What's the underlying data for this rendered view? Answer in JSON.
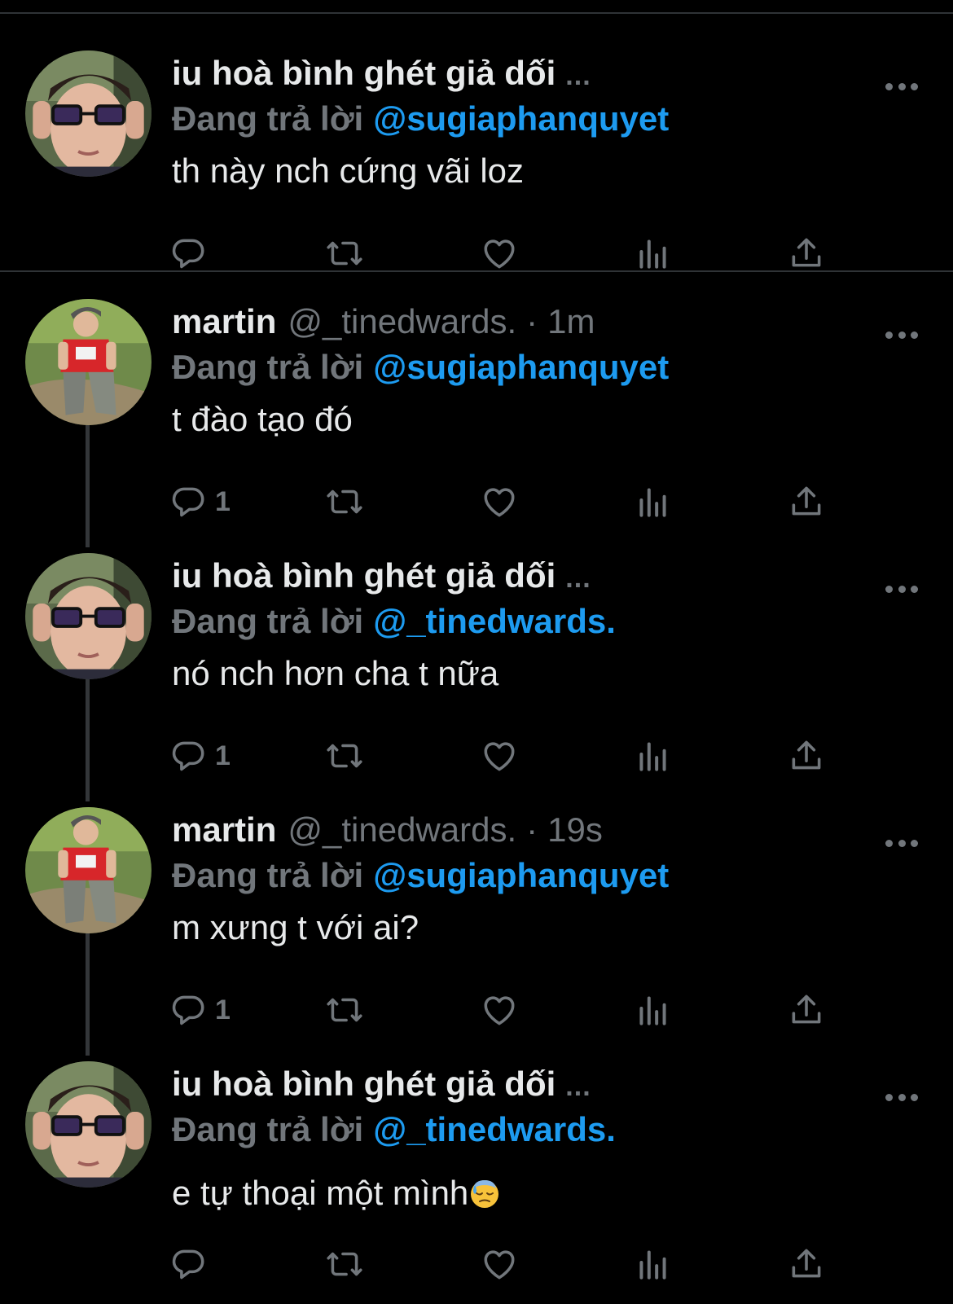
{
  "colors": {
    "background": "#000000",
    "text": "#e7e9ea",
    "muted": "#71767b",
    "accent": "#1d9bf0",
    "divider": "#2f3336"
  },
  "reply_prefix": "Đang trả lời",
  "ellipsis": "...",
  "tweets": [
    {
      "author_name": "iu hoà bình ghét giả dối",
      "handle": "",
      "time": "",
      "reply_to": "@sugiaphanquyet",
      "text": "th này nch cứng vãi loz",
      "reply_count": "",
      "avatar": "avatar-glasses"
    },
    {
      "author_name": "martin",
      "handle": "@_tinedwards.",
      "separator": "·",
      "time": "1m",
      "reply_to": "@sugiaphanquyet",
      "text": "t đào tạo đó",
      "reply_count": "1",
      "avatar": "avatar-red-shirt"
    },
    {
      "author_name": "iu hoà bình ghét giả dối",
      "handle": "",
      "time": "",
      "reply_to": "@_tinedwards.",
      "text": "nó nch hơn cha t nữa",
      "reply_count": "1",
      "avatar": "avatar-glasses"
    },
    {
      "author_name": "martin",
      "handle": "@_tinedwards.",
      "separator": "·",
      "time": "19s",
      "reply_to": "@sugiaphanquyet",
      "text": "m xưng t với ai?",
      "reply_count": "1",
      "avatar": "avatar-red-shirt"
    },
    {
      "author_name": "iu hoà bình ghét giả dối",
      "handle": "",
      "time": "",
      "reply_to": "@_tinedwards.",
      "text": "e tự thoại một mình",
      "text_emoji": "downcast-face-with-sweat-emoji",
      "reply_count": "",
      "avatar": "avatar-glasses"
    }
  ],
  "action_icons": [
    "reply-icon",
    "retweet-icon",
    "like-icon",
    "views-icon",
    "share-icon"
  ]
}
